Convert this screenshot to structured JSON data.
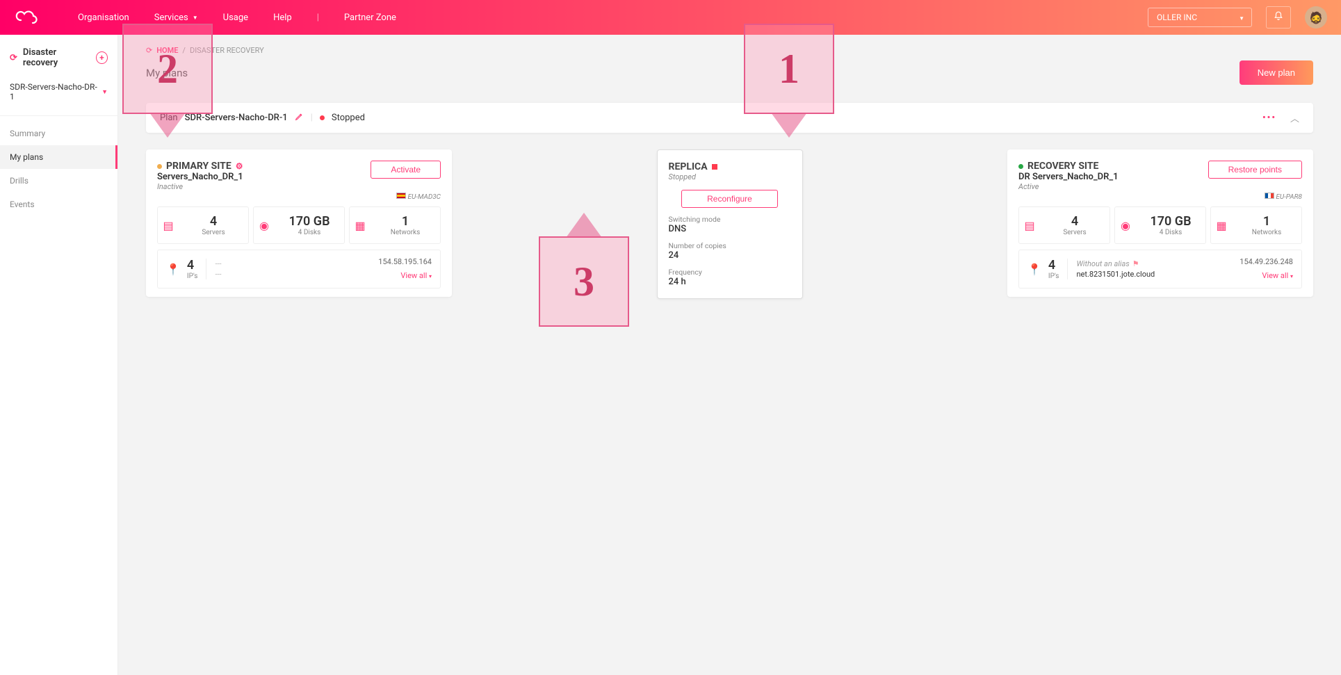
{
  "nav": {
    "items": [
      "Organisation",
      "Services",
      "Usage",
      "Help"
    ],
    "partner": "Partner Zone",
    "org": "OLLER INC"
  },
  "sidebar": {
    "title": "Disaster recovery",
    "plan": "SDR-Servers-Nacho-DR-1",
    "links": [
      "Summary",
      "My plans",
      "Drills",
      "Events"
    ]
  },
  "breadcrumb": {
    "home": "HOME",
    "current": "DISASTER RECOVERY"
  },
  "page": {
    "title": "My plans",
    "new": "New plan"
  },
  "planbar": {
    "prefix": "Plan",
    "name": "SDR-Servers-Nacho-DR-1",
    "status": "Stopped"
  },
  "primary": {
    "title": "PRIMARY SITE",
    "name": "Servers_Nacho_DR_1",
    "state": "Inactive",
    "action": "Activate",
    "region": "EU-MAD3C",
    "servers_val": "4",
    "servers_lbl": "Servers",
    "storage_val": "170 GB",
    "storage_lbl": "4 Disks",
    "networks_val": "1",
    "networks_lbl": "Networks",
    "ips_val": "4",
    "ips_lbl": "IP's",
    "dash1": "---",
    "dash2": "---",
    "ip_addr": "154.58.195.164",
    "view_all": "View all"
  },
  "replica": {
    "title": "REPLICA",
    "state": "Stopped",
    "action": "Reconfigure",
    "switch_lbl": "Switching mode",
    "switch_val": "DNS",
    "copies_lbl": "Number of copies",
    "copies_val": "24",
    "freq_lbl": "Frequency",
    "freq_val": "24 h"
  },
  "recovery": {
    "title": "RECOVERY SITE",
    "name": "DR Servers_Nacho_DR_1",
    "state": "Active",
    "action": "Restore points",
    "region": "EU-PAR8",
    "servers_val": "4",
    "servers_lbl": "Servers",
    "storage_val": "170 GB",
    "storage_lbl": "4 Disks",
    "networks_val": "1",
    "networks_lbl": "Networks",
    "ips_val": "4",
    "ips_lbl": "IP's",
    "alias_txt": "Without an alias",
    "net": "net.8231501.jote.cloud",
    "ip_addr": "154.49.236.248",
    "view_all": "View all"
  },
  "callouts": {
    "c1": "1",
    "c2": "2",
    "c3": "3"
  }
}
